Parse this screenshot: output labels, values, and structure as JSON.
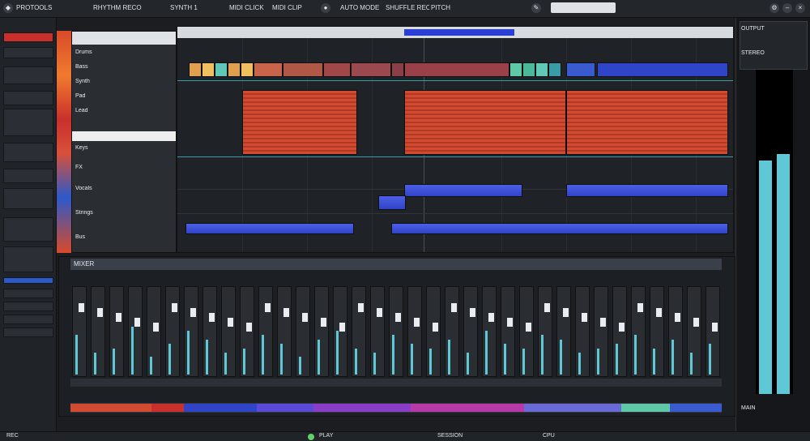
{
  "toolbar": {
    "app_label": "PROTOOLS",
    "menu_1": "RHYTHM RECORD",
    "menu_2": "SYNTH 1",
    "menu_3": "MIDI CLICK",
    "menu_4": "MIDI CLIP",
    "menu_5": "AUTO MODE",
    "menu_6": "SHUFFLE RECORD",
    "menu_7": "PITCH",
    "search_placeholder": ""
  },
  "tracklist": {
    "rows": [
      "Drums",
      "Bass",
      "Synth",
      "Pad",
      "Lead",
      "Keys",
      "FX",
      "Vocals",
      "Strings",
      "Bus"
    ]
  },
  "mixer": {
    "label": "MIXER",
    "channel_levels": [
      0.45,
      0.25,
      0.3,
      0.55,
      0.2,
      0.35,
      0.5,
      0.4,
      0.25,
      0.3,
      0.45,
      0.35,
      0.2,
      0.4,
      0.5,
      0.3,
      0.25,
      0.45,
      0.35,
      0.3,
      0.4,
      0.25,
      0.5,
      0.35,
      0.3,
      0.45,
      0.4,
      0.25,
      0.3,
      0.35,
      0.45,
      0.3,
      0.4,
      0.25,
      0.35
    ]
  },
  "meter": {
    "title": "OUTPUT",
    "subtitle": "STEREO",
    "level_left": 0.72,
    "level_right": 0.74,
    "footer": "MAIN"
  },
  "status": {
    "left": "REC",
    "center_1": "PLAY",
    "center_2": "SESSION",
    "right": "CPU"
  },
  "colors": {
    "accent_red": "#d24a2f",
    "accent_blue": "#3044c8",
    "accent_cyan": "#5fc8d6"
  }
}
